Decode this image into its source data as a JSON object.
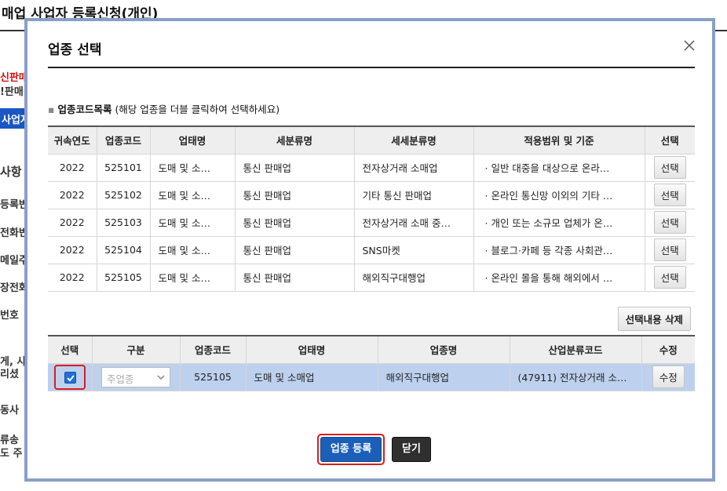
{
  "background": {
    "title": "매업 사업자 등록신청(개인)",
    "left_fragments": [
      {
        "text": "신판매",
        "red": true
      },
      {
        "text": "!판매",
        "red": false
      },
      {
        "text": "사업자",
        "blue": true
      },
      {
        "text": "사항",
        "red": false
      },
      {
        "text": "등록번",
        "red": false
      },
      {
        "text": "전화번",
        "red": false
      },
      {
        "text": "메일주",
        "red": false
      },
      {
        "text": "장전화",
        "red": false
      },
      {
        "text": "번호",
        "red": false
      },
      {
        "text": "게, 사",
        "red": false
      },
      {
        "text": "리셨",
        "red": false
      },
      {
        "text": "동사",
        "red": false
      },
      {
        "text": "류송",
        "red": false
      },
      {
        "text": "도 주",
        "red": false
      }
    ]
  },
  "modal": {
    "title": "업종 선택",
    "section_label": "업종코드목록",
    "section_hint": "(해당 업종을 더블 클릭하여 선택하세요)",
    "code_table": {
      "headers": [
        "귀속연도",
        "업종코드",
        "업태명",
        "세분류명",
        "세세분류명",
        "적용범위 및 기준",
        "선택"
      ],
      "rows": [
        {
          "year": "2022",
          "code": "525101",
          "biz_type": "도매 및 소…",
          "sub": "통신 판매업",
          "subsub": "전자상거래 소매업",
          "scope": "· 일반 대중을 대상으로 온라…",
          "btn": "선택"
        },
        {
          "year": "2022",
          "code": "525102",
          "biz_type": "도매 및 소…",
          "sub": "통신 판매업",
          "subsub": "기타 통신 판매업",
          "scope": "· 온라인 통신망 이외의 기타 …",
          "btn": "선택"
        },
        {
          "year": "2022",
          "code": "525103",
          "biz_type": "도매 및 소…",
          "sub": "통신 판매업",
          "subsub": "전자상거래 소매 중…",
          "scope": "· 개인 또는 소규모 업체가 온…",
          "btn": "선택"
        },
        {
          "year": "2022",
          "code": "525104",
          "biz_type": "도매 및 소…",
          "sub": "통신 판매업",
          "subsub": "SNS마켓",
          "scope": "· 블로그·카페 등 각종 사회관…",
          "btn": "선택"
        },
        {
          "year": "2022",
          "code": "525105",
          "biz_type": "도매 및 소…",
          "sub": "통신 판매업",
          "subsub": "해외직구대행업",
          "scope": "·  온라인 몰을 통해 해외에서 …",
          "btn": "선택"
        }
      ]
    },
    "delete_selected_label": "선택내용 삭제",
    "selected_table": {
      "headers": [
        "선택",
        "구분",
        "업종코드",
        "업태명",
        "업종명",
        "산업분류코드",
        "수정"
      ],
      "rows": [
        {
          "checked": true,
          "category": "주업종",
          "code": "525105",
          "biz_type": "도매 및 소매업",
          "biz_name": "해외직구대행업",
          "industry_code": "(47911) 전자상거래 소…",
          "btn": "수정"
        }
      ]
    },
    "register_label": "업종 등록",
    "close_label": "닫기"
  }
}
